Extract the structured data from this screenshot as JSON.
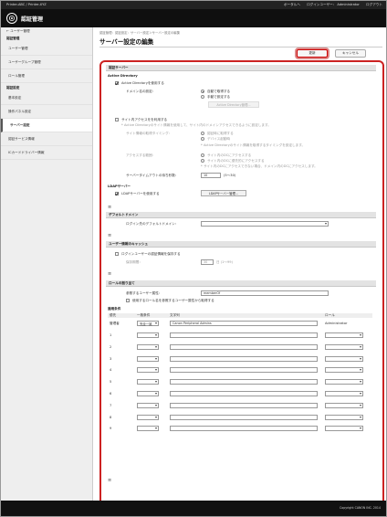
{
  "topbar": {
    "left_text": "Printer-ABC / Printer-XYZ",
    "portal": "ポータルへ",
    "login_user_label": "ログインユーザー：",
    "login_user": "Administrator",
    "logout": "ログアウト"
  },
  "app": {
    "title": "認証管理"
  },
  "sidebar": {
    "back_link": "← ユーザー管理",
    "section1": "認証管理",
    "items1": [
      "ユーザー管理",
      "ユーザーグループ管理",
      "ロール管理"
    ],
    "section2": "認証設定",
    "items2": [
      "基本設定",
      "操作パネル設定",
      "サーバー設定",
      "認証サービス情報",
      "ICカードドライバー情報"
    ],
    "active": "サーバー設定"
  },
  "main": {
    "breadcrumb": "認証管理：認証設定：サーバー設定＞サーバー設定の編集",
    "title": "サーバー設定の編集",
    "update_button": "更新",
    "cancel_button": "キャンセル"
  },
  "auth_server": {
    "header": "認証サーバー",
    "ad_section": "Active Directory",
    "ad_enable": "Active Directoryを使用する",
    "domain_label": "ドメイン名の設定：",
    "domain_auto": "自動で取得する",
    "domain_manual": "手動で設定する",
    "ad_manage_button": "Active Directory管理...",
    "site_access": "サイト内アクセスをを利用する",
    "site_note": "* Active Directoryのサイト情報を使用して、サイト内のドメインアクセスできるように設定します。",
    "site_info_label": "サイト情報の取得タイミング：",
    "site_opt1": "認証時に取得する",
    "site_opt2": "デバイス起動時",
    "site_note2": "* Active Directoryのサイト情報を取得するタイミングを設定します。",
    "range_label": "アクセスする範囲：",
    "range_opt1": "サイト内のDCにアクセスする",
    "range_opt2": "サイト内のDCに優先的にアクセスする",
    "range_note": "* サイト内のDCにアクセスできない場合、ドメイン内のDCにアクセスします。",
    "timeout_label": "サーバータイムアウトの待ち秒数：",
    "timeout_value": "10",
    "timeout_range": "(5〜30)",
    "ldap_section": "LDAPサーバー",
    "ldap_enable": "LDAPサーバーを使用する",
    "ldap_button": "LDAPサーバー管理..."
  },
  "default_domain": {
    "header": "デフォルトドメイン",
    "label": "ログイン先のデフォルトドメイン：",
    "value": ""
  },
  "cache": {
    "header": "ユーザー情報のキャッシュ",
    "enable": "ログインユーザーの認証情報を保存する",
    "period_label": "保存期間：",
    "period_value": "30",
    "period_unit": "日 (1〜99)"
  },
  "role": {
    "header": "ロールの割り当て",
    "attr_label": "参照するユーザー属性：",
    "attr_value": "memberOf",
    "use_attr": "使用するロール名を参照するユーザー属性から取得する",
    "cond_title": "適用条件",
    "col_priority": "優先",
    "col_match": "一致条件",
    "col_string": "文字列",
    "col_role": "ロール",
    "admin_label": "管理者",
    "admin_match": "完全一致",
    "admin_string": "Canon Peripheral Admins",
    "admin_role": "Administrator",
    "rows": [
      "1",
      "2",
      "3",
      "4",
      "5",
      "6",
      "7",
      "8",
      "9"
    ]
  },
  "footer": {
    "copyright": "Copyright CANON INC. 2014"
  },
  "collapse_mark": "≡"
}
